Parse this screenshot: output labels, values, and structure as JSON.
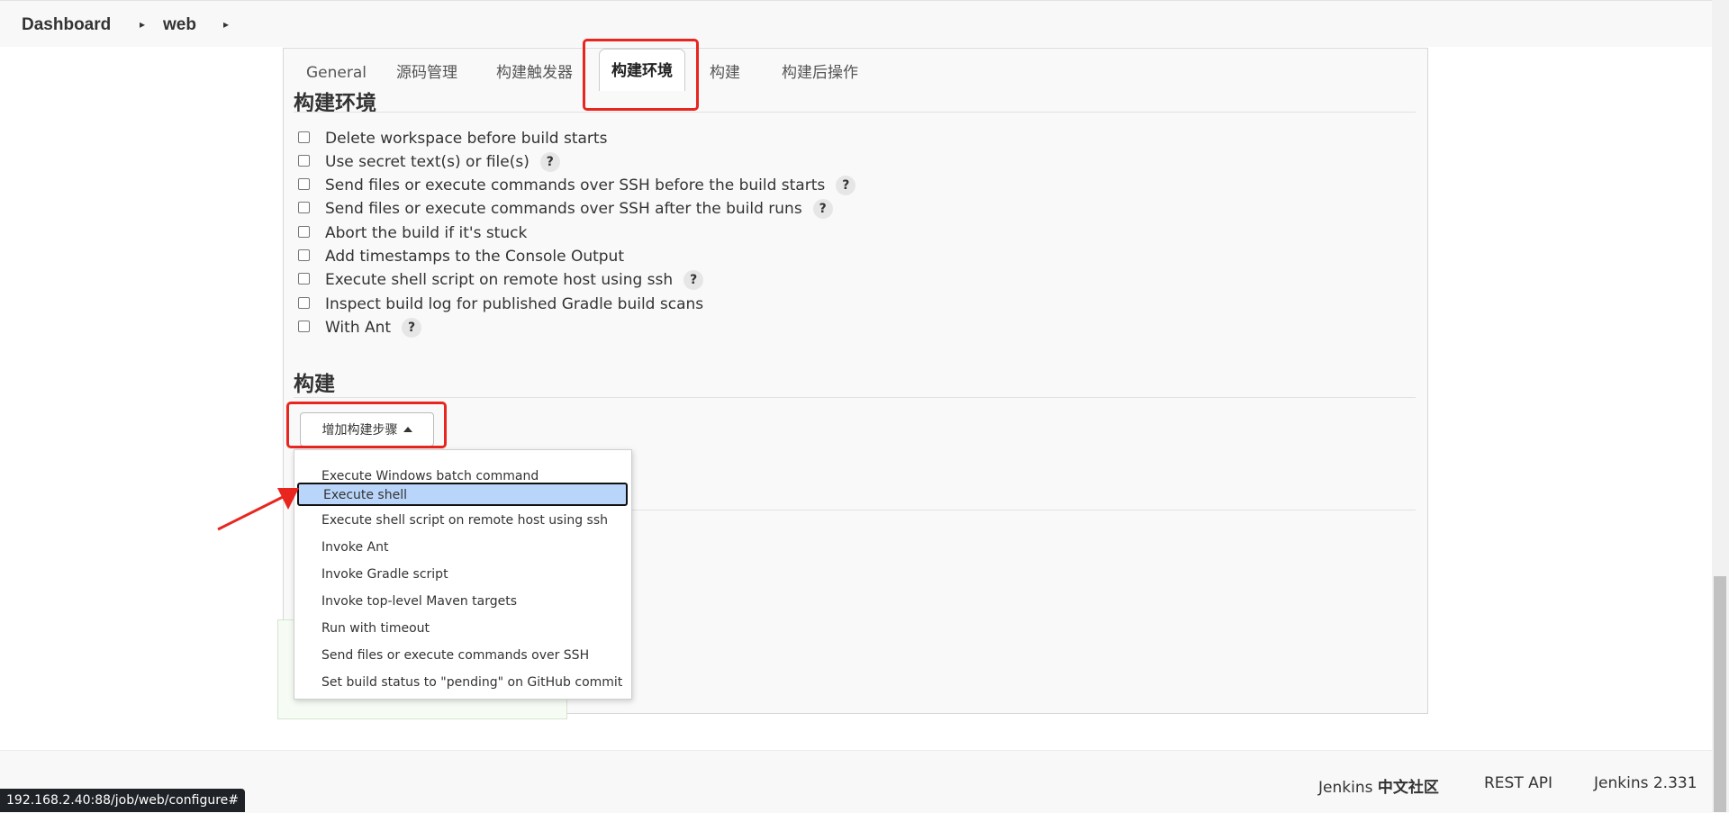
{
  "breadcrumb": {
    "items": [
      "Dashboard",
      "web"
    ],
    "separator_glyph": "▸"
  },
  "tabs": [
    "General",
    "源码管理",
    "构建触发器",
    "构建环境",
    "构建",
    "构建后操作"
  ],
  "active_tab": "构建环境",
  "build_env": {
    "title": "构建环境",
    "options": [
      {
        "label": "Delete workspace before build starts",
        "help": false
      },
      {
        "label": "Use secret text(s) or file(s)",
        "help": true
      },
      {
        "label": "Send files or execute commands over SSH before the build starts",
        "help": true
      },
      {
        "label": "Send files or execute commands over SSH after the build runs",
        "help": true
      },
      {
        "label": "Abort the build if it's stuck",
        "help": false
      },
      {
        "label": "Add timestamps to the Console Output",
        "help": false
      },
      {
        "label": "Execute shell script on remote host using ssh",
        "help": true
      },
      {
        "label": "Inspect build log for published Gradle build scans",
        "help": false
      },
      {
        "label": "With Ant",
        "help": true
      }
    ],
    "help_glyph": "?"
  },
  "build": {
    "title": "构建",
    "add_step_button": "增加构建步骤"
  },
  "add_step_menu": {
    "items": [
      "Execute Windows batch command",
      "Execute shell",
      "Execute shell script on remote host using ssh",
      "Invoke Ant",
      "Invoke Gradle script",
      "Invoke top-level Maven targets",
      "Run with timeout",
      "Send files or execute commands over SSH",
      "Set build status to \"pending\" on GitHub commit"
    ],
    "selected": "Execute shell"
  },
  "footer": {
    "community_prefix": "Jenkins",
    "community_suffix": "中文社区",
    "rest_api": "REST API",
    "version": "Jenkins 2.331"
  },
  "status_url": "192.168.2.40:88/job/web/configure#",
  "colors": {
    "highlight": "#e8261f",
    "menu_selected": "#b9d5fa",
    "arrow": "#e8261f"
  }
}
